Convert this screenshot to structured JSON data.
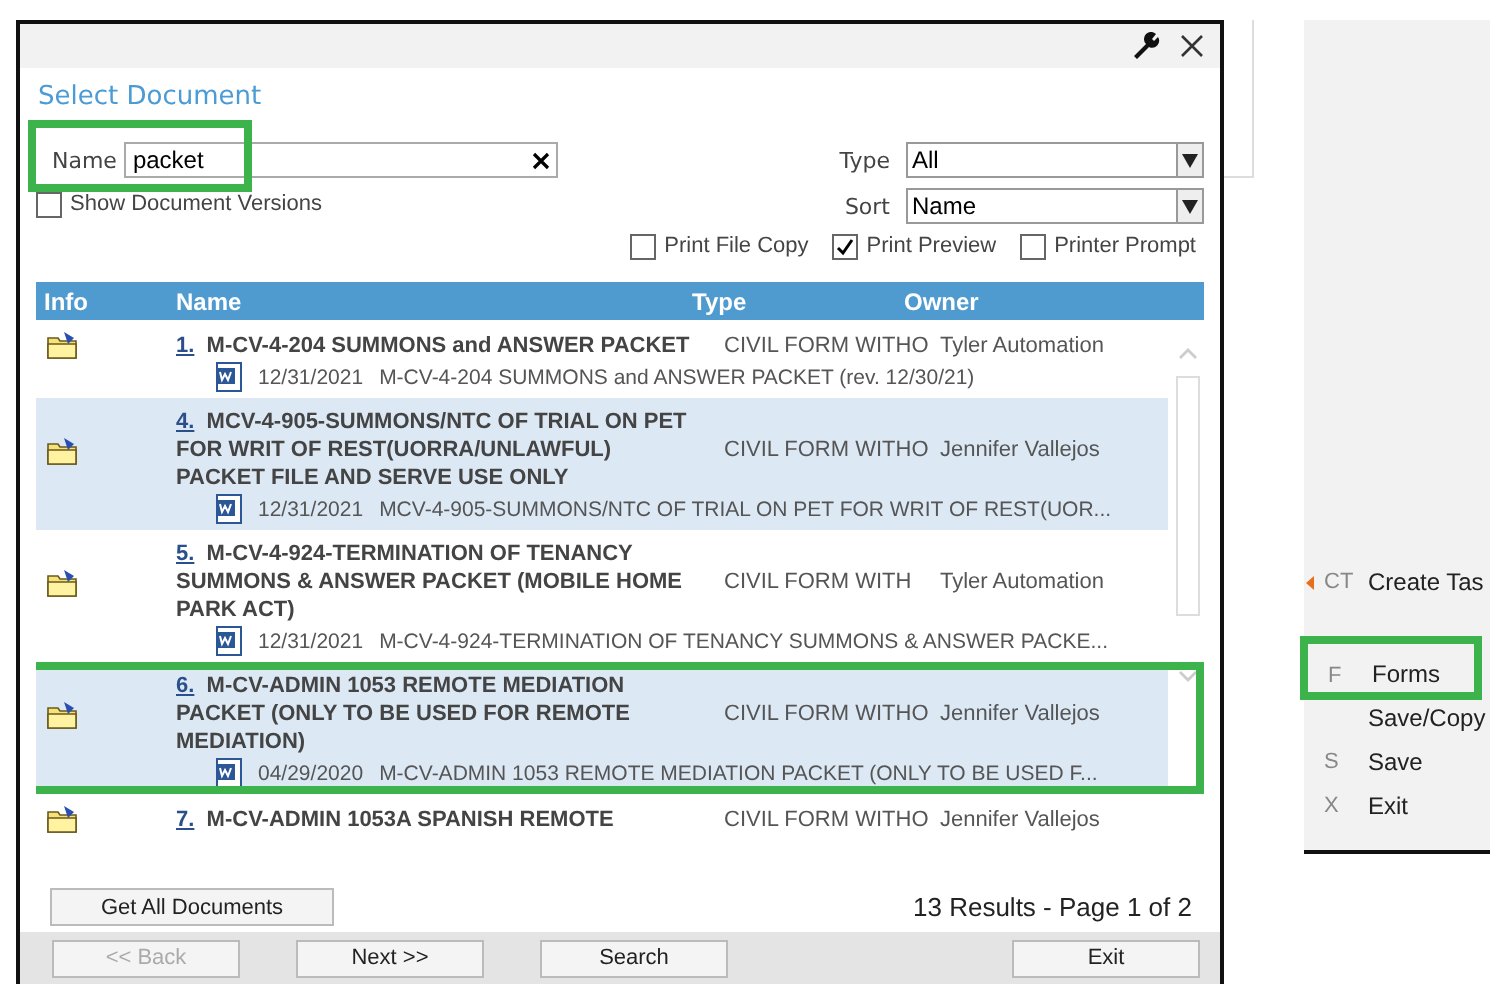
{
  "dialog": {
    "title": "Select Document",
    "name_field": {
      "label": "Name",
      "value": "packet",
      "annotated": true
    },
    "show_versions": {
      "label": "Show Document Versions",
      "checked": false
    },
    "type_select": {
      "label": "Type",
      "value": "All"
    },
    "sort_select": {
      "label": "Sort",
      "value": "Name"
    },
    "print_options": [
      {
        "label": "Print File Copy",
        "checked": false
      },
      {
        "label": "Print Preview",
        "checked": true
      },
      {
        "label": "Printer Prompt",
        "checked": false
      }
    ],
    "columns": [
      "Info",
      "Name",
      "Type",
      "Owner"
    ],
    "rows": [
      {
        "number": "1.",
        "name": "M-CV-4-204 SUMMONS and ANSWER PACKET",
        "type": "CIVIL FORM WITHO",
        "owner": "Tyler Automation",
        "version_date": "12/31/2021",
        "version_name": "M-CV-4-204 SUMMONS and ANSWER PACKET (rev. 12/30/21)",
        "annotated": false
      },
      {
        "number": "4.",
        "name": "MCV-4-905-SUMMONS/NTC OF TRIAL ON PET FOR WRIT OF REST(UORRA/UNLAWFUL) PACKET FILE AND SERVE USE ONLY",
        "type": "CIVIL FORM WITHO",
        "owner": "Jennifer Vallejos",
        "version_date": "12/31/2021",
        "version_name": "MCV-4-905-SUMMONS/NTC OF TRIAL ON PET FOR WRIT OF REST(UOR...",
        "annotated": false
      },
      {
        "number": "5.",
        "name": "M-CV-4-924-TERMINATION OF TENANCY SUMMONS & ANSWER PACKET (MOBILE HOME PARK ACT)",
        "type": "CIVIL FORM WITH",
        "owner": "Tyler Automation",
        "version_date": "12/31/2021",
        "version_name": "M-CV-4-924-TERMINATION OF TENANCY SUMMONS & ANSWER PACKE...",
        "annotated": false
      },
      {
        "number": "6.",
        "name": "M-CV-ADMIN 1053 REMOTE MEDIATION PACKET (ONLY TO BE USED FOR REMOTE MEDIATION)",
        "type": "CIVIL FORM WITHO",
        "owner": "Jennifer Vallejos",
        "version_date": "04/29/2020",
        "version_name": "M-CV-ADMIN 1053 REMOTE MEDIATION PACKET (ONLY TO BE USED F...",
        "annotated": true
      },
      {
        "number": "7.",
        "name": "M-CV-ADMIN 1053A SPANISH REMOTE",
        "type": "CIVIL FORM WITHO",
        "owner": "Jennifer Vallejos",
        "annotated": false
      }
    ],
    "get_all_button": "Get All Documents",
    "results": "13 Results - Page 1 of 2",
    "buttons": [
      {
        "label": "<< Back",
        "disabled": true
      },
      {
        "label": "Next >>",
        "disabled": false
      },
      {
        "label": "Search",
        "disabled": false
      },
      {
        "label": "Exit",
        "disabled": false
      }
    ]
  },
  "side_menu": [
    {
      "shortcut": "CT",
      "label": "Create Tas",
      "marker": true,
      "annotated": false
    },
    {
      "shortcut": "F",
      "label": "Forms",
      "marker": false,
      "annotated": true
    },
    {
      "label": "Save/Copy",
      "marker": false,
      "annotated": false
    },
    {
      "shortcut": "S",
      "label": "Save",
      "marker": false,
      "annotated": false
    },
    {
      "shortcut": "X",
      "label": "Exit",
      "marker": false,
      "annotated": false
    }
  ]
}
